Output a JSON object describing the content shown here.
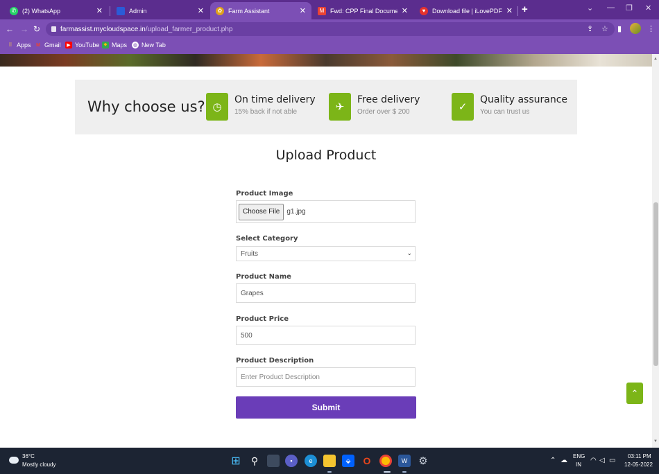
{
  "browser": {
    "tabs": [
      {
        "title": "(2) WhatsApp",
        "icon": "whatsapp-icon",
        "color": "#25d366"
      },
      {
        "title": "Admin",
        "icon": "admin-icon",
        "color": "#2b5bd7"
      },
      {
        "title": "Farm Assistant",
        "icon": "farm-icon",
        "color": "#e0a21a"
      },
      {
        "title": "Fwd: CPP Final Documents group",
        "icon": "gmail-icon",
        "color": "#ea4335"
      },
      {
        "title": "Download file | iLovePDF",
        "icon": "ilovepdf-icon",
        "color": "#e5322d"
      }
    ],
    "new_tab_glyph": "+",
    "url_host": "farmassist.mycloudspace.in",
    "url_path": "/upload_farmer_product.php",
    "bookmarks": [
      {
        "label": "Apps",
        "icon": "apps-grid-icon",
        "color": "#4285f4"
      },
      {
        "label": "Gmail",
        "icon": "gmail-icon",
        "color": "#ea4335"
      },
      {
        "label": "YouTube",
        "icon": "youtube-icon",
        "color": "#ff0000"
      },
      {
        "label": "Maps",
        "icon": "maps-icon",
        "color": "#34a853"
      },
      {
        "label": "New Tab",
        "icon": "globe-icon",
        "color": "#ffffff"
      }
    ]
  },
  "why": {
    "title": "Why choose us?",
    "features": [
      {
        "title": "On time delivery",
        "subtitle": "15% back if not able",
        "icon": "clock-icon"
      },
      {
        "title": "Free delivery",
        "subtitle": "Order over $ 200",
        "icon": "plane-icon"
      },
      {
        "title": "Quality assurance",
        "subtitle": "You can trust us",
        "icon": "check-circle-icon"
      }
    ]
  },
  "form": {
    "heading": "Upload Product",
    "image_label": "Product Image",
    "choose_file_label": "Choose File",
    "file_name": "g1.jpg",
    "category_label": "Select Category",
    "category_value": "Fruits",
    "name_label": "Product Name",
    "name_value": "Grapes",
    "price_label": "Product Price",
    "price_value": "500",
    "description_label": "Product Description",
    "description_placeholder": "Enter Product Description",
    "submit_label": "Submit"
  },
  "accent": {
    "purple": "#6a3db8",
    "green": "#7cb518"
  },
  "taskbar": {
    "temperature": "36°C",
    "weather": "Mostly cloudy",
    "lang_top": "ENG",
    "lang_bottom": "IN",
    "time": "03:11 PM",
    "date": "12-05-2022"
  }
}
